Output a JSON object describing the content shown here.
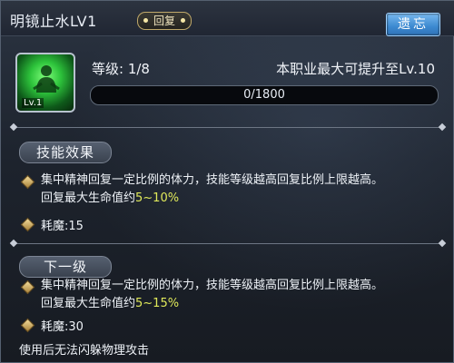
{
  "header": {
    "skill_name": "明镜止水LV1",
    "skill_type": "回复",
    "forget_button": "遗忘"
  },
  "skill": {
    "icon_level": "Lv.1",
    "level_label": "等级: 1/8",
    "max_level_text": "本职业最大可提升至Lv.10",
    "progress_text": "0/1800",
    "progress_value": 0
  },
  "current": {
    "header": "技能效果",
    "desc_line1": "集中精神回复一定比例的体力，技能等级越高回复比例上限越高。",
    "desc_line2_prefix": "回复最大生命值约",
    "desc_line2_value": "5~10%",
    "cost": "耗魔:15"
  },
  "next": {
    "header": "下一级",
    "desc_line1": "集中精神回复一定比例的体力，技能等级越高回复比例上限越高。",
    "desc_line2_prefix": "回复最大生命值约",
    "desc_line2_value": "5~15%",
    "cost": "耗魔:30"
  },
  "footer_note": "使用后无法闪躲物理攻击",
  "colors": {
    "accent_blue": "#3c89d0",
    "highlight_yellow": "#e0e95a",
    "icon_green": "#2dc33b"
  }
}
